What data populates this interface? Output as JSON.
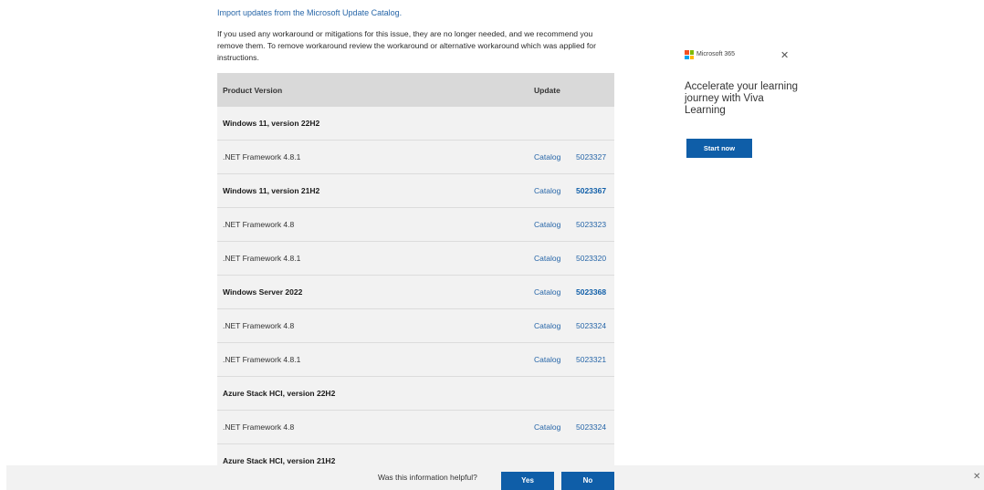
{
  "top_link": "Import updates from the Microsoft Update Catalog.",
  "intro": "If you used any workaround or mitigations for this issue, they are no longer needed, and we recommend you remove them. To remove workaround review the workaround or alternative workaround which was applied for instructions.",
  "table": {
    "headers": {
      "product": "Product Version",
      "update": "Update"
    },
    "rows": [
      {
        "product": "Windows 11, version 22H2",
        "bold": true,
        "catalog": "",
        "kb": ""
      },
      {
        "product": ".NET Framework 4.8.1",
        "bold": false,
        "catalog": "Catalog",
        "kb": "5023327"
      },
      {
        "product": "Windows 11, version 21H2",
        "bold": true,
        "catalog": "Catalog",
        "kb": "5023367"
      },
      {
        "product": ".NET Framework 4.8",
        "bold": false,
        "catalog": "Catalog",
        "kb": "5023323"
      },
      {
        "product": ".NET Framework 4.8.1",
        "bold": false,
        "catalog": "Catalog",
        "kb": "5023320"
      },
      {
        "product": "Windows Server 2022",
        "bold": true,
        "catalog": "Catalog",
        "kb": "5023368"
      },
      {
        "product": ".NET Framework 4.8",
        "bold": false,
        "catalog": "Catalog",
        "kb": "5023324"
      },
      {
        "product": ".NET Framework 4.8.1",
        "bold": false,
        "catalog": "Catalog",
        "kb": "5023321"
      },
      {
        "product": "Azure Stack HCI, version 22H2",
        "bold": true,
        "catalog": "",
        "kb": ""
      },
      {
        "product": ".NET Framework 4.8",
        "bold": false,
        "catalog": "Catalog",
        "kb": "5023324"
      },
      {
        "product": "Azure Stack HCI, version 21H2",
        "bold": true,
        "catalog": "",
        "kb": ""
      }
    ]
  },
  "sidebar_ad": {
    "brand": "Microsoft 365",
    "close_icon": "close-icon",
    "headline": "Accelerate your learning journey with Viva Learning",
    "button": "Start now",
    "logo_colors": [
      "#f25022",
      "#7fba00",
      "#00a4ef",
      "#ffb900"
    ]
  },
  "feedback": {
    "question": "Was this information helpful?",
    "yes": "Yes",
    "no": "No",
    "close_icon": "close-icon"
  },
  "colors": {
    "link": "#2766a8",
    "button": "#0f5ea8",
    "table_header": "#d9d9d9",
    "table_row": "#f2f2f2"
  }
}
